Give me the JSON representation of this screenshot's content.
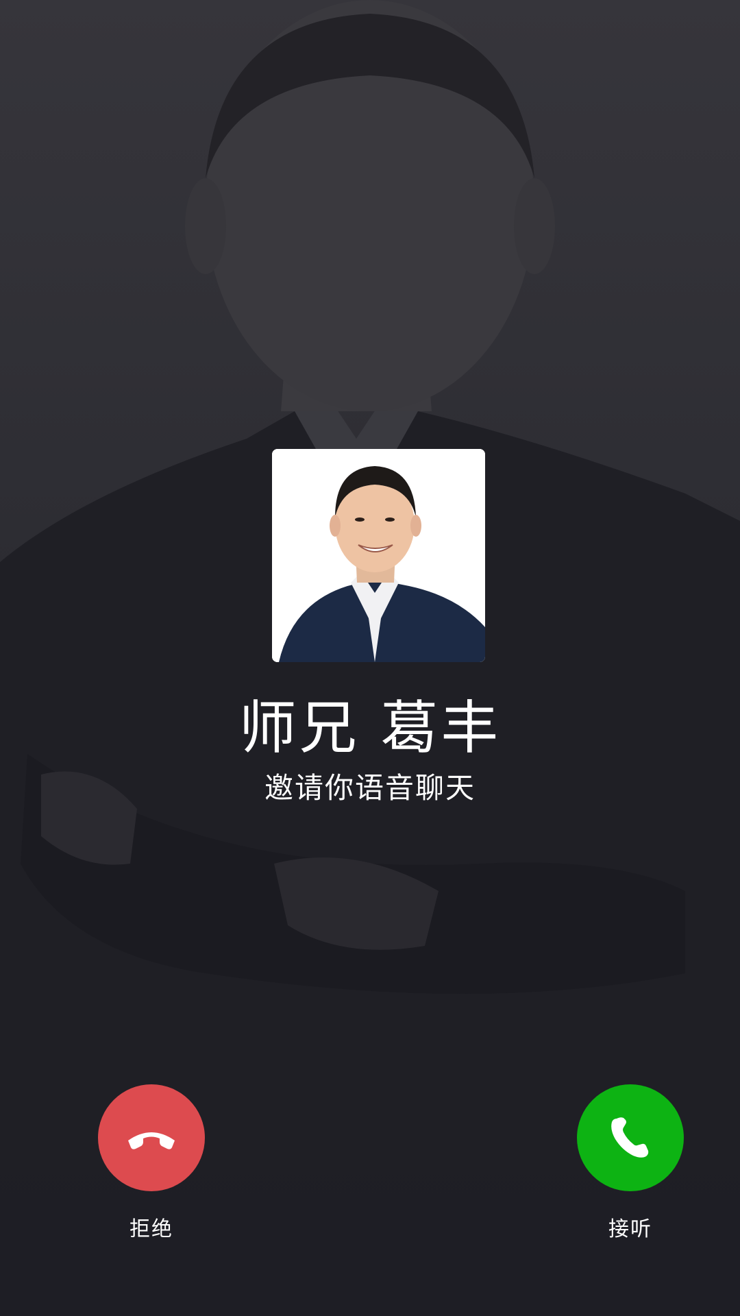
{
  "caller": {
    "name": "师兄 葛丰",
    "subtitle": "邀请你语音聊天"
  },
  "actions": {
    "decline_label": "拒绝",
    "accept_label": "接听"
  },
  "icons": {
    "decline": "phone-hangup-icon",
    "accept": "phone-icon"
  },
  "colors": {
    "decline": "#dd4b4f",
    "accept": "#0db313",
    "text": "#ffffff"
  }
}
